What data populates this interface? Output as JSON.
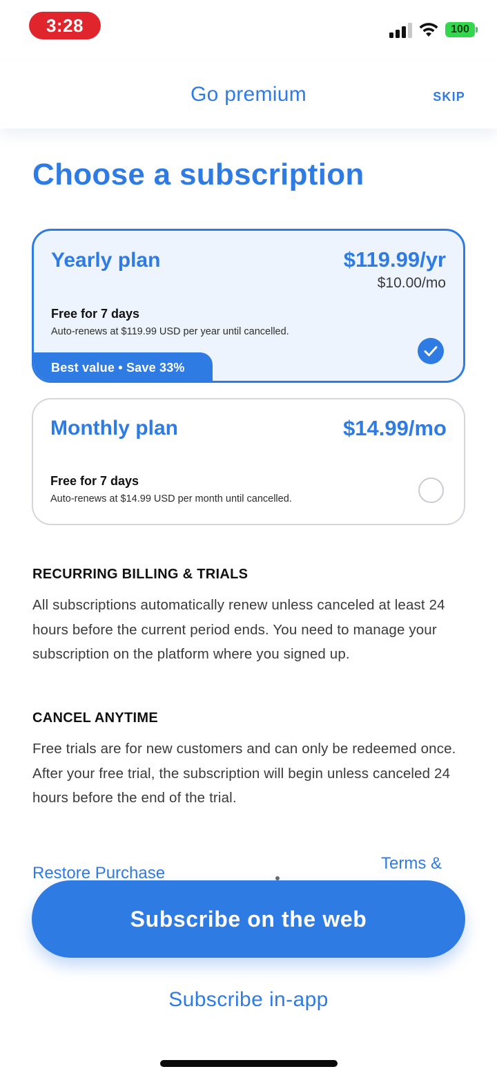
{
  "status_bar": {
    "time": "3:28",
    "battery": "100"
  },
  "header": {
    "title": "Go premium",
    "skip_label": "SKIP"
  },
  "page_title": "Choose a subscription",
  "plans": [
    {
      "name": "Yearly plan",
      "price": "$119.99/yr",
      "sub_price": "$10.00/mo",
      "trial": "Free for 7 days",
      "renew": "Auto-renews at $119.99 USD per year until cancelled.",
      "badge": "Best value • Save 33%",
      "selected": true
    },
    {
      "name": "Monthly plan",
      "price": "$14.99/mo",
      "trial": "Free for 7 days",
      "renew": "Auto-renews at $14.99 USD per month until cancelled.",
      "selected": false
    }
  ],
  "sections": [
    {
      "heading": "RECURRING BILLING & TRIALS",
      "body": "All subscriptions automatically renew unless canceled at least 24 hours before the current period ends. You need to manage your subscription on the platform where you signed up."
    },
    {
      "heading": "CANCEL ANYTIME",
      "body": "Free trials are for new customers and can only be redeemed once. After your free trial, the subscription will begin unless canceled 24 hours before the end of the trial."
    }
  ],
  "links": {
    "restore": "Restore Purchase",
    "terms": "Terms &"
  },
  "buttons": {
    "web": "Subscribe on the web",
    "in_app": "Subscribe in-app"
  },
  "colors": {
    "accent": "#2f7be4",
    "selected_bg": "#eef4fd",
    "status_time_bg": "#e0252d",
    "battery": "#32d74b"
  },
  "icons": [
    "signal-icon",
    "wifi-icon",
    "battery-icon",
    "checkmark-icon",
    "radio-empty-icon"
  ]
}
